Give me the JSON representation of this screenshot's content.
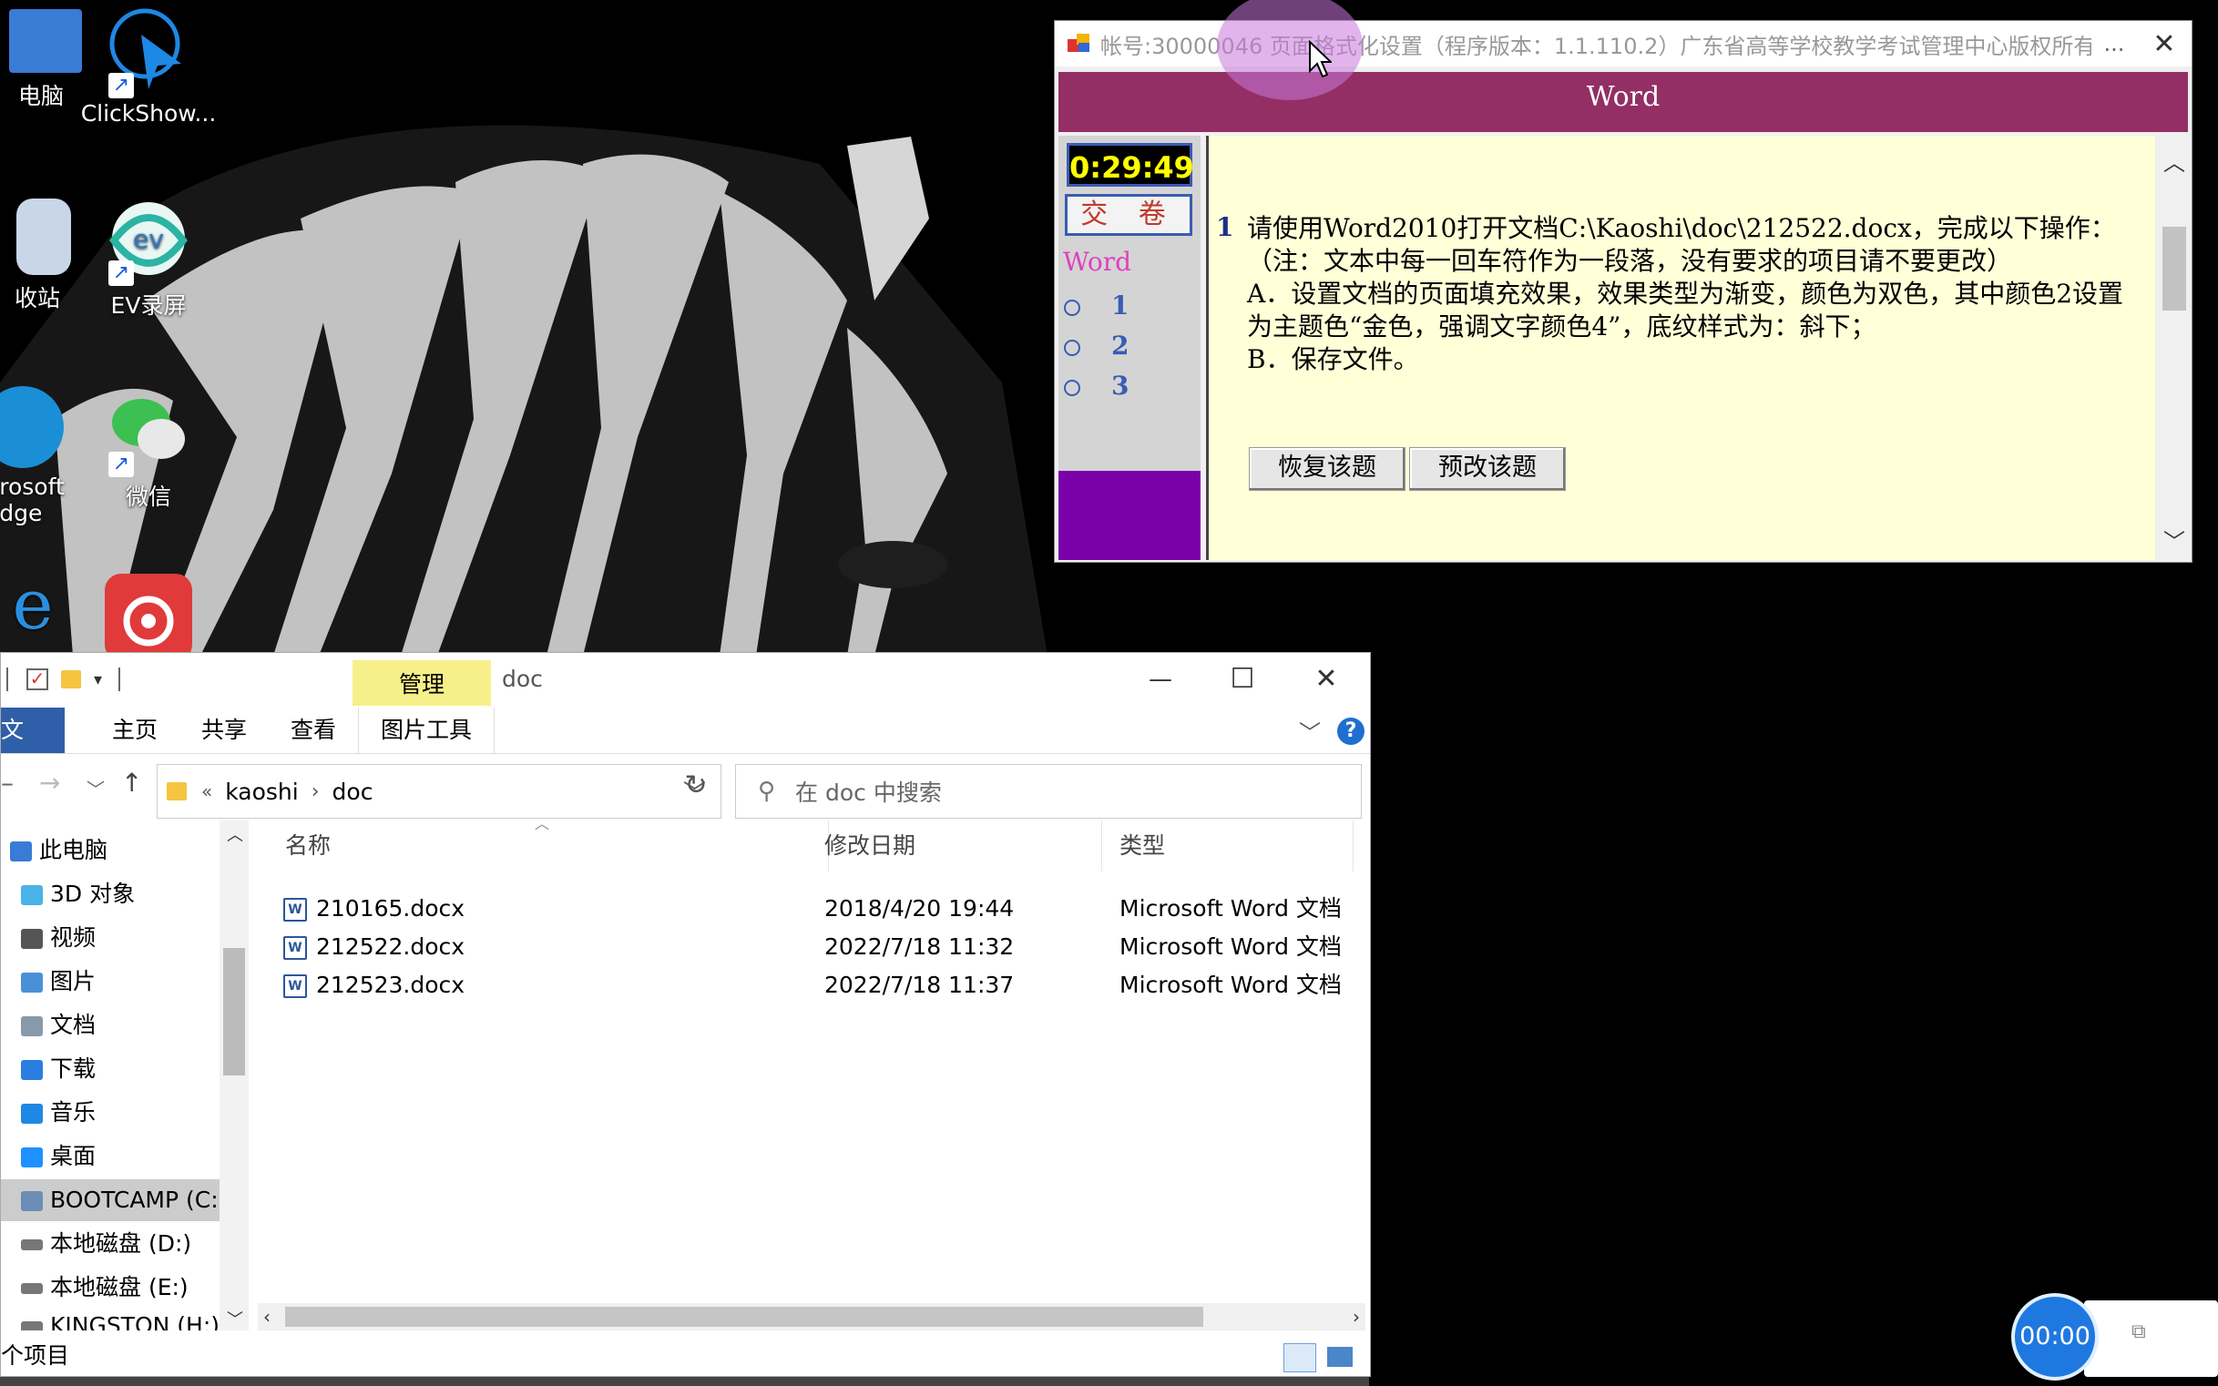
{
  "desktop": {
    "icons": [
      {
        "label": "电脑",
        "icon": "computer-icon"
      },
      {
        "label": "ClickShow...",
        "icon": "clickshow-icon"
      },
      {
        "label": "收站",
        "icon": "recycle-bin-icon"
      },
      {
        "label": "EV录屏",
        "icon": "ev-recorder-icon"
      },
      {
        "label": "rosoft\ndge",
        "icon": "edge-icon"
      },
      {
        "label": "微信",
        "icon": "wechat-icon"
      },
      {
        "label": "",
        "icon": "ie-icon"
      },
      {
        "label": "",
        "icon": "netease-music-icon"
      }
    ]
  },
  "exam": {
    "title": "帐号:30000046  页面格式化设置（程序版本：1.1.110.2）广东省高等学校教学考试管理中心版权所有",
    "more": "...",
    "close": "✕",
    "band_title": "Word",
    "timer": "0:29:49",
    "submit": "交 卷",
    "section": "Word",
    "questions": [
      "1",
      "2",
      "3"
    ],
    "question_number": "1",
    "question_lines": [
      "请使用Word2010打开文档C:\\Kaoshi\\doc\\212522.docx，完成以下操作：（注：文本中每一回车符作为一段落，没有要求的项目请不要更改）",
      "A．设置文档的页面填充效果，效果类型为渐变，颜色为双色，其中颜色2设置为主题色“金色，强调文字颜色4”，底纹样式为：斜下；",
      "B．保存文件。"
    ],
    "restore_button": "恢复该题",
    "preview_button": "预改该题"
  },
  "explorer": {
    "title": "doc",
    "manage_tab": "管理",
    "minimize": "—",
    "maximize": "☐",
    "close": "✕",
    "ribbon_tabs": [
      "文件",
      "主页",
      "共享",
      "查看",
      "图片工具"
    ],
    "address": {
      "overflow": "«",
      "segments": [
        "kaoshi",
        "doc"
      ]
    },
    "search_placeholder": "在 doc 中搜索",
    "nav_items": [
      {
        "label": "此电脑",
        "color": "#3a7bd5"
      },
      {
        "label": "3D 对象",
        "color": "#4ab3e8"
      },
      {
        "label": "视频",
        "color": "#555555"
      },
      {
        "label": "图片",
        "color": "#4a90d9"
      },
      {
        "label": "文档",
        "color": "#8899aa"
      },
      {
        "label": "下载",
        "color": "#2a7de1"
      },
      {
        "label": "音乐",
        "color": "#1e88e5"
      },
      {
        "label": "桌面",
        "color": "#1e90ff"
      },
      {
        "label": "BOOTCAMP (C:",
        "color": "#6b8db5"
      },
      {
        "label": "本地磁盘 (D:)",
        "color": "#777777"
      },
      {
        "label": "本地磁盘 (E:)",
        "color": "#777777"
      },
      {
        "label": "KINGSTON (H:)",
        "color": "#777777"
      }
    ],
    "columns": [
      "名称",
      "修改日期",
      "类型"
    ],
    "files": [
      {
        "name": "210165.docx",
        "date": "2018/4/20 19:44",
        "type": "Microsoft Word 文档"
      },
      {
        "name": "212522.docx",
        "date": "2022/7/18 11:32",
        "type": "Microsoft Word 文档"
      },
      {
        "name": "212523.docx",
        "date": "2022/7/18 11:37",
        "type": "Microsoft Word 文档"
      }
    ],
    "status": "个项目"
  },
  "recorder": {
    "time": "00:00"
  },
  "colors": {
    "exam_band": "#932f64",
    "exam_side_purple": "#7a00a8",
    "exam_content_bg": "#ffffd8",
    "explorer_file_tab": "#2f5fa8",
    "manage_tab": "#f7f08a"
  }
}
